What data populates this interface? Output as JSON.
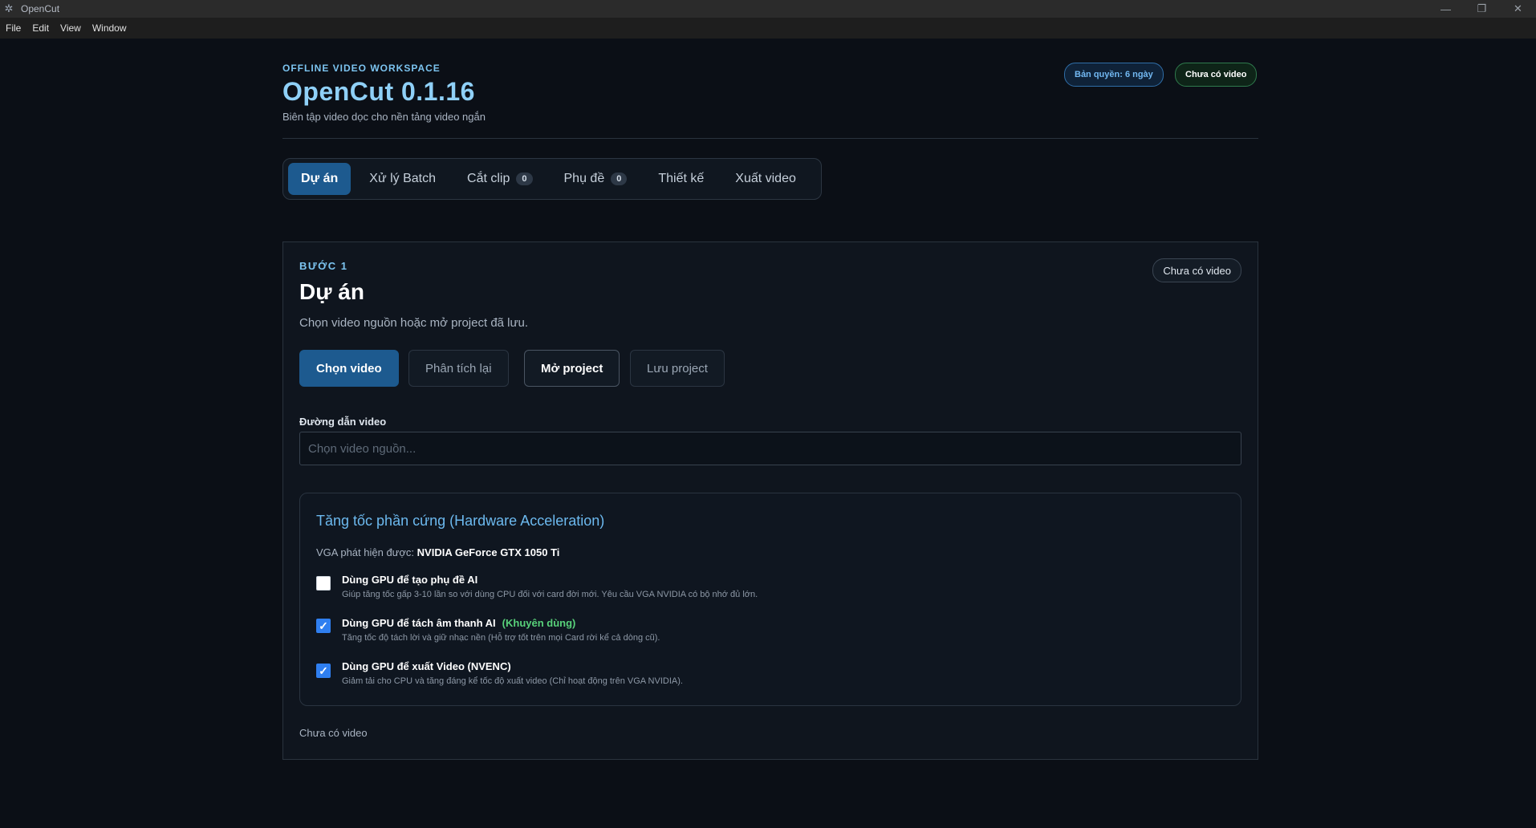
{
  "window": {
    "title": "OpenCut",
    "menu": [
      "File",
      "Edit",
      "View",
      "Window"
    ]
  },
  "header": {
    "eyebrow": "OFFLINE VIDEO WORKSPACE",
    "title": "OpenCut 0.1.16",
    "subtitle": "Biên tập video dọc cho nền tảng video ngắn",
    "license_pill": "Bản quyền: 6 ngày",
    "status_pill": "Chưa có video"
  },
  "tabs": [
    {
      "label": "Dự án",
      "count": null,
      "active": true
    },
    {
      "label": "Xử lý Batch",
      "count": null,
      "active": false
    },
    {
      "label": "Cắt clip",
      "count": "0",
      "active": false
    },
    {
      "label": "Phụ đề",
      "count": "0",
      "active": false
    },
    {
      "label": "Thiết kế",
      "count": null,
      "active": false
    },
    {
      "label": "Xuất video",
      "count": null,
      "active": false
    }
  ],
  "step": {
    "label": "BƯỚC 1",
    "title": "Dự án",
    "description": "Chọn video nguồn hoặc mở project đã lưu.",
    "badge": "Chưa có video",
    "buttons": {
      "choose_video": "Chọn video",
      "reanalyze": "Phân tích lại",
      "open_project": "Mở project",
      "save_project": "Lưu project"
    },
    "video_path": {
      "label": "Đường dẫn video",
      "value": "",
      "placeholder": "Chọn video nguồn..."
    },
    "footer_status": "Chưa có video"
  },
  "hardware": {
    "title": "Tăng tốc phần cứng (Hardware Acceleration)",
    "vga_label": "VGA phát hiện được:",
    "vga_name": "NVIDIA GeForce GTX 1050 Ti",
    "options": [
      {
        "title": "Dùng GPU để tạo phụ đề AI",
        "recommended": "",
        "description": "Giúp tăng tốc gấp 3-10 lần so với dùng CPU đối với card đời mới. Yêu cầu VGA NVIDIA có bộ nhớ đủ lớn.",
        "checked": false
      },
      {
        "title": "Dùng GPU để tách âm thanh AI",
        "recommended": "(Khuyên dùng)",
        "description": "Tăng tốc độ tách lời và giữ nhạc nền (Hỗ trợ tốt trên mọi Card rời kể cả dòng cũ).",
        "checked": true
      },
      {
        "title": "Dùng GPU để xuất Video (NVENC)",
        "recommended": "",
        "description": "Giảm tải cho CPU và tăng đáng kể tốc độ xuất video (Chỉ hoạt động trên VGA NVIDIA).",
        "checked": true
      }
    ]
  }
}
